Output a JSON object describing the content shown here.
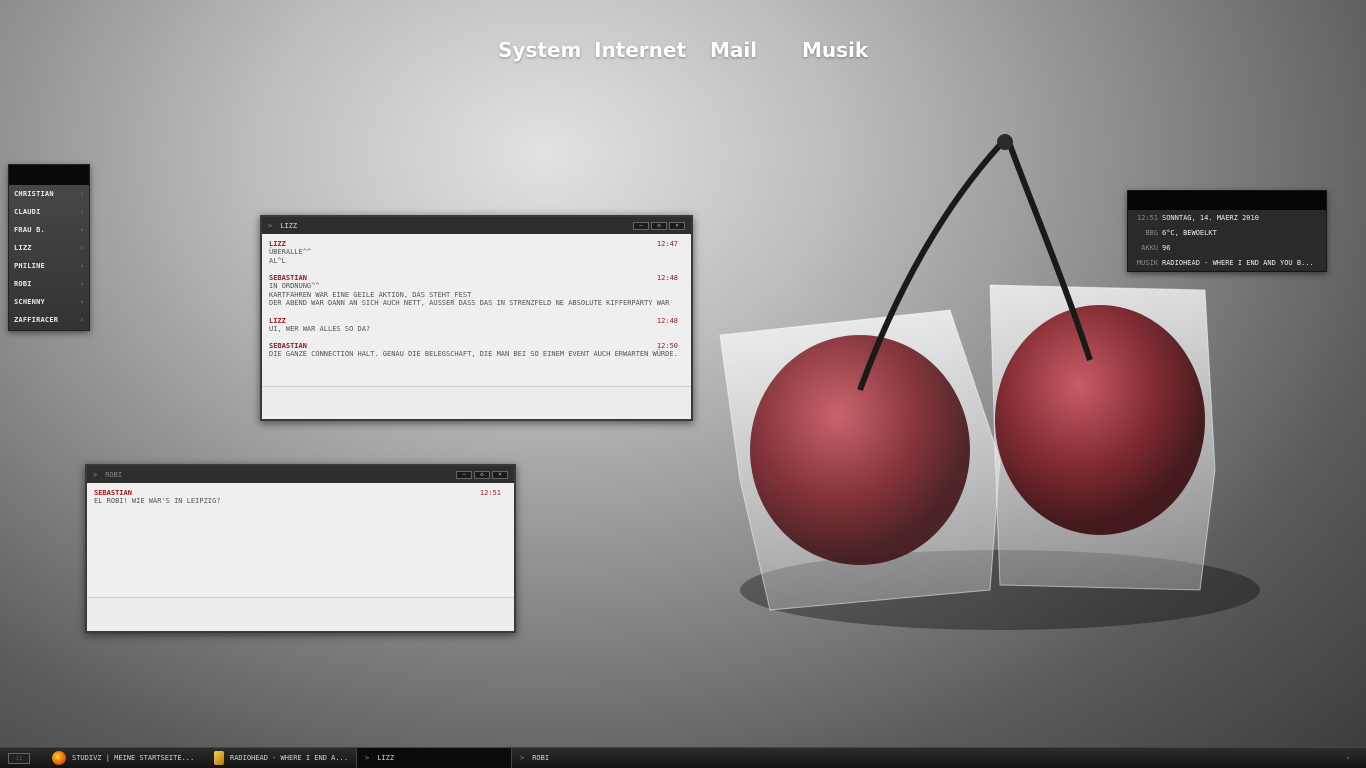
{
  "top_menu": {
    "items": [
      "System",
      "Internet",
      "Mail",
      "Musik"
    ]
  },
  "contacts": {
    "items": [
      {
        "name": "CHRISTIAN"
      },
      {
        "name": "CLAUDI"
      },
      {
        "name": "FRAU B."
      },
      {
        "name": "LIZZ"
      },
      {
        "name": "PHILINE"
      },
      {
        "name": "ROBI"
      },
      {
        "name": "SCHENNY"
      },
      {
        "name": "ZAFFIRACER"
      }
    ],
    "chevron": "›"
  },
  "chat_lizz": {
    "title": "LIZZ",
    "buttons": [
      "–",
      "◇",
      "×"
    ],
    "messages": [
      {
        "sender": "LIZZ",
        "time": "12:47",
        "lines": [
          "ÜBERALLE^^",
          "AL^L"
        ]
      },
      {
        "sender": "SEBASTIAN",
        "time": "12:48",
        "lines": [
          "IN ORDNUNG^^",
          "KARTFAHREN WAR EINE GEILE AKTION, DAS STEHT FEST",
          "DER ABEND WAR DANN AN SICH AUCH NETT, AUSSER DASS DAS IN STRENZFELD NE ABSOLUTE KIFFERPARTY WAR"
        ]
      },
      {
        "sender": "LIZZ",
        "time": "12:48",
        "lines": [
          "UI, WER WAR ALLES SO DA?"
        ]
      },
      {
        "sender": "SEBASTIAN",
        "time": "12:50",
        "lines": [
          "DIE GANZE CONNECTION HALT. GENAU DIE BELEGSCHAFT, DIE MAN BEI SO EINEM EVENT AUCH ERWARTEN WÜRDE."
        ]
      }
    ]
  },
  "chat_robi": {
    "title": "ROBI",
    "buttons": [
      "–",
      "◇",
      "×"
    ],
    "messages": [
      {
        "sender": "SEBASTIAN",
        "time": "12:51",
        "lines": [
          "EL ROBI! WIE WAR'S IN LEIPZIG?"
        ]
      }
    ]
  },
  "info_widget": {
    "rows": [
      {
        "label": "12:51",
        "value": "SONNTAG, 14. MAERZ 2010"
      },
      {
        "label": "BBG",
        "value": "6°C, BEWOELKT"
      },
      {
        "label": "AKKU",
        "value": "96"
      },
      {
        "label": "MUSIK",
        "value": "RADIOHEAD - WHERE I END AND YOU B..."
      }
    ]
  },
  "taskbar": {
    "start_label": "::",
    "tasks": [
      {
        "label": "STUDIVZ | MEINE STARTSEITE...",
        "icon": "firefox-icon",
        "color": "#e66000"
      },
      {
        "label": "RADIOHEAD - WHERE I END A...",
        "icon": "winamp-icon",
        "color": "#d4a017"
      },
      {
        "label": "LIZZ",
        "icon": "chat-arrow"
      },
      {
        "label": "ROBI",
        "icon": "chat-arrow"
      }
    ],
    "tray_arrow": "‹"
  }
}
